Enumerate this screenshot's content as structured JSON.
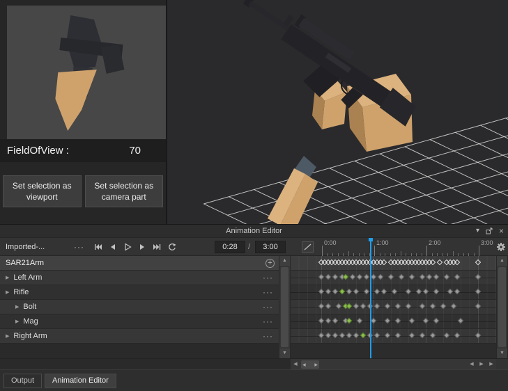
{
  "icons": {
    "ellipsis": "···",
    "plus": "+",
    "close": "×",
    "chevron_down": "▾",
    "expander": "▶",
    "up_arrow": "▲",
    "down_arrow": "▼",
    "left_arrow": "◀",
    "right_arrow": "▶"
  },
  "colors": {
    "playhead": "#1f9fee",
    "keyframe_gray": "#9b9b9b",
    "keyframe_green": "#8cbf4d",
    "keyframe_outline": "#e6e6e6",
    "arm_tan": "#cfa26c",
    "arm_tan_light": "#dcb27e",
    "arm_tan_dark": "#aa8150",
    "rifle_dark": "#232327",
    "grid": "#dcdcdc",
    "hand_gray": "#4d5964"
  },
  "camera_panel": {
    "field_of_view_label": "FieldOfView :",
    "field_of_view_value": "70",
    "viewport_button": {
      "line1": "Set selection as",
      "line2": "viewport"
    },
    "camera_part_button": {
      "line1": "Set selection as",
      "line2": "camera part"
    }
  },
  "animation_editor": {
    "title": "Animation Editor",
    "animation_name": "Imported-...",
    "time_current": "0:28",
    "time_separator": "/",
    "time_total": "3:00",
    "root_track": "SAR21Arm",
    "tracks": [
      {
        "label": "Left Arm",
        "indent": 0
      },
      {
        "label": "Rifle",
        "indent": 0
      },
      {
        "label": "Bolt",
        "indent": 1
      },
      {
        "label": "Mag",
        "indent": 1
      },
      {
        "label": "Right Arm",
        "indent": 0
      }
    ],
    "timeline": {
      "duration_seconds": 3,
      "playhead_seconds": 0.933,
      "ruler_seconds": [
        0,
        1,
        2,
        3
      ],
      "ruler_labels": [
        "0:00",
        "1:00",
        "2:00",
        "3:00"
      ],
      "summary_keyframes": [
        0,
        0.067,
        0.133,
        0.2,
        0.267,
        0.333,
        0.4,
        0.467,
        0.533,
        0.6,
        0.667,
        0.733,
        0.8,
        0.867,
        0.933,
        1.0,
        1.067,
        1.133,
        1.2,
        1.333,
        1.4,
        1.467,
        1.533,
        1.6,
        1.667,
        1.733,
        1.8,
        1.867,
        1.933,
        2.0,
        2.067,
        2.133,
        2.267,
        2.4,
        2.467,
        2.533,
        2.6,
        3.0
      ],
      "track_keyframes": [
        {
          "track": "Left Arm",
          "keys": [
            [
              0
            ],
            [
              0.133
            ],
            [
              0.267
            ],
            [
              0.4
            ],
            [
              0.467,
              "g"
            ],
            [
              0.6
            ],
            [
              0.733
            ],
            [
              0.867
            ],
            [
              1.0
            ],
            [
              1.133
            ],
            [
              1.333
            ],
            [
              1.533
            ],
            [
              1.733
            ],
            [
              1.933
            ],
            [
              2.067
            ],
            [
              2.2
            ],
            [
              2.4
            ],
            [
              2.6
            ],
            [
              3.0
            ]
          ]
        },
        {
          "track": "Rifle",
          "keys": [
            [
              0
            ],
            [
              0.133
            ],
            [
              0.267
            ],
            [
              0.4,
              "g"
            ],
            [
              0.533
            ],
            [
              0.667
            ],
            [
              0.867
            ],
            [
              1.067
            ],
            [
              1.2
            ],
            [
              1.4
            ],
            [
              1.667
            ],
            [
              1.867
            ],
            [
              2.0
            ],
            [
              2.2
            ],
            [
              2.467
            ],
            [
              2.6
            ],
            [
              3.0
            ]
          ]
        },
        {
          "track": "Bolt",
          "keys": [
            [
              0
            ],
            [
              0.133
            ],
            [
              0.333
            ],
            [
              0.467,
              "g"
            ],
            [
              0.533,
              "g"
            ],
            [
              0.667
            ],
            [
              0.8
            ],
            [
              0.933
            ],
            [
              1.067
            ],
            [
              1.267
            ],
            [
              1.467
            ],
            [
              1.667
            ],
            [
              1.933
            ],
            [
              2.133
            ],
            [
              2.333
            ],
            [
              2.533
            ],
            [
              3.0
            ]
          ]
        },
        {
          "track": "Mag",
          "keys": [
            [
              0
            ],
            [
              0.133
            ],
            [
              0.267
            ],
            [
              0.467
            ],
            [
              0.533,
              "g"
            ],
            [
              0.733
            ],
            [
              1.0
            ],
            [
              1.267
            ],
            [
              1.467
            ],
            [
              1.733
            ],
            [
              2.0
            ],
            [
              2.2
            ],
            [
              2.667
            ]
          ]
        },
        {
          "track": "Right Arm",
          "keys": [
            [
              0
            ],
            [
              0.133
            ],
            [
              0.267
            ],
            [
              0.4
            ],
            [
              0.533
            ],
            [
              0.667
            ],
            [
              0.8,
              "g"
            ],
            [
              0.933
            ],
            [
              1.067
            ],
            [
              1.267
            ],
            [
              1.467
            ],
            [
              1.733
            ],
            [
              1.933
            ],
            [
              2.133
            ],
            [
              2.4
            ],
            [
              2.6
            ],
            [
              3.0
            ]
          ]
        }
      ]
    }
  },
  "status_bar": {
    "tabs": [
      {
        "label": "Output"
      },
      {
        "label": "Animation Editor"
      }
    ]
  }
}
